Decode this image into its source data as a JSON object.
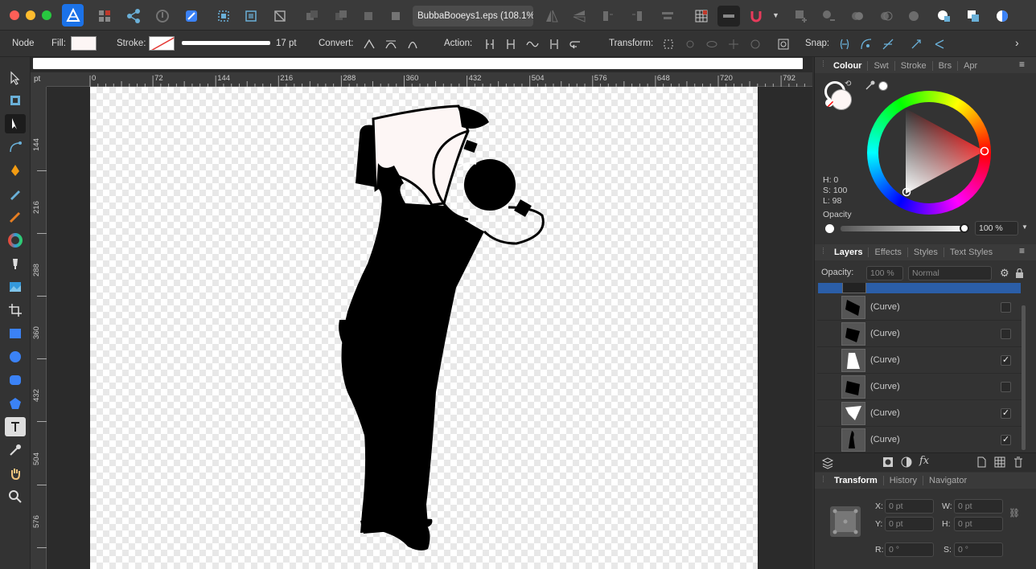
{
  "document": {
    "tab_title": "BubbaBooeys1.eps (108.1%",
    "modified_mark": "★"
  },
  "context_toolbar": {
    "tool_name": "Node",
    "fill_label": "Fill:",
    "stroke_label": "Stroke:",
    "stroke_width": "17 pt",
    "convert_label": "Convert:",
    "action_label": "Action:",
    "transform_label": "Transform:",
    "snap_label": "Snap:"
  },
  "rulers": {
    "unit": "pt",
    "top_ticks": [
      "0",
      "72",
      "144",
      "216",
      "288",
      "360",
      "432",
      "504",
      "576",
      "648",
      "720",
      "792"
    ],
    "left_ticks": [
      "144",
      "216",
      "288",
      "360",
      "432",
      "504",
      "576"
    ]
  },
  "colour_panel": {
    "tabs": [
      "Colour",
      "Swt",
      "Stroke",
      "Brs",
      "Apr"
    ],
    "active_tab": "Colour",
    "h": "H: 0",
    "s": "S: 100",
    "l": "L: 98",
    "opacity_label": "Opacity",
    "opacity_value": "100 %",
    "fill_color": "#fdf6f5"
  },
  "layers_panel": {
    "tabs": [
      "Layers",
      "Effects",
      "Styles",
      "Text Styles"
    ],
    "active_tab": "Layers",
    "opacity_label": "Opacity:",
    "opacity_value": "100 %",
    "blend_mode": "Normal",
    "rows": [
      {
        "name": "(Curve)",
        "checked": ""
      },
      {
        "name": "(Curve)",
        "checked": ""
      },
      {
        "name": "(Curve)",
        "checked": "✓"
      },
      {
        "name": "(Curve)",
        "checked": ""
      },
      {
        "name": "(Curve)",
        "checked": "✓"
      },
      {
        "name": "(Curve)",
        "checked": "✓"
      }
    ]
  },
  "transform_panel": {
    "tabs": [
      "Transform",
      "History",
      "Navigator"
    ],
    "active_tab": "Transform",
    "x_label": "X:",
    "x_value": "0 pt",
    "y_label": "Y:",
    "y_value": "0 pt",
    "w_label": "W:",
    "w_value": "0 pt",
    "h_label": "H:",
    "h_value": "0 pt",
    "r_label": "R:",
    "r_value": "0 °",
    "s_label": "S:",
    "s_value": "0 °"
  },
  "colors": {
    "accent": "#3b82f6",
    "selection": "#2b5ea8"
  }
}
